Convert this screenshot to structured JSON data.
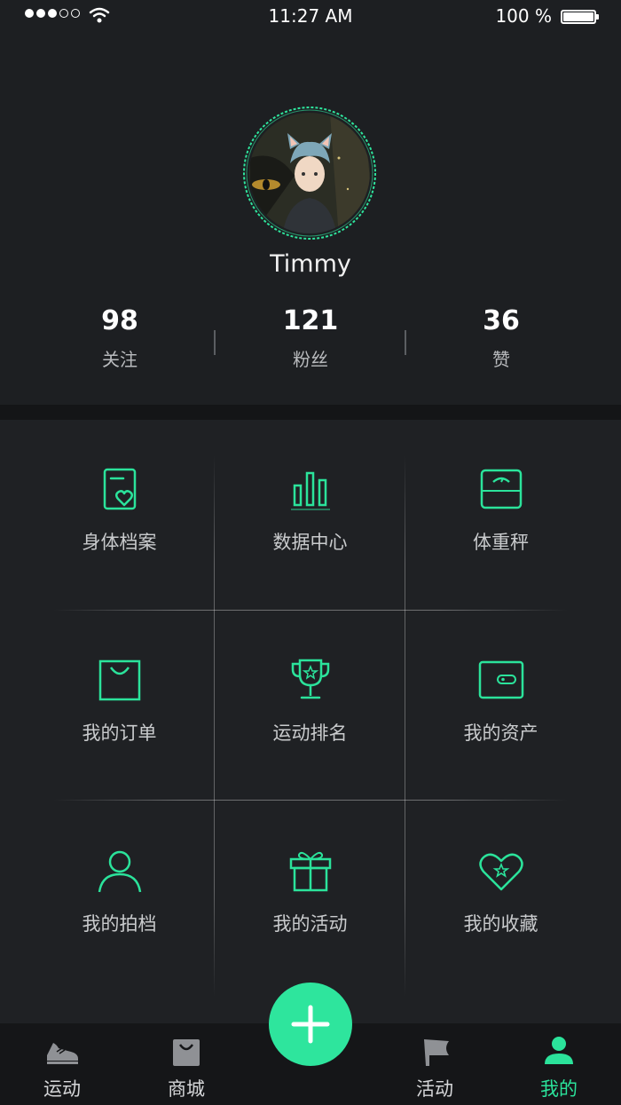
{
  "status_bar": {
    "time": "11:27 AM",
    "battery": "100 %"
  },
  "profile": {
    "username": "Timmy"
  },
  "stats": [
    {
      "value": "98",
      "label": "关注"
    },
    {
      "value": "121",
      "label": "粉丝"
    },
    {
      "value": "36",
      "label": "赞"
    }
  ],
  "menu": [
    {
      "label": "身体档案",
      "icon": "body-profile-icon"
    },
    {
      "label": "数据中心",
      "icon": "bar-chart-icon"
    },
    {
      "label": "体重秤",
      "icon": "scale-icon"
    },
    {
      "label": "我的订单",
      "icon": "shopping-bag-icon"
    },
    {
      "label": "运动排名",
      "icon": "trophy-icon"
    },
    {
      "label": "我的资产",
      "icon": "wallet-icon"
    },
    {
      "label": "我的拍档",
      "icon": "person-icon"
    },
    {
      "label": "我的活动",
      "icon": "gift-icon"
    },
    {
      "label": "我的收藏",
      "icon": "heart-star-icon"
    }
  ],
  "tabs": [
    {
      "label": "运动",
      "icon": "sneaker-icon"
    },
    {
      "label": "商城",
      "icon": "shop-bag-icon"
    },
    {
      "label": "活动",
      "icon": "flag-icon"
    },
    {
      "label": "我的",
      "icon": "user-icon",
      "active": true
    }
  ],
  "colors": {
    "accent": "#2be39b",
    "background": "#1d1f22",
    "tabbar": "#151618"
  }
}
